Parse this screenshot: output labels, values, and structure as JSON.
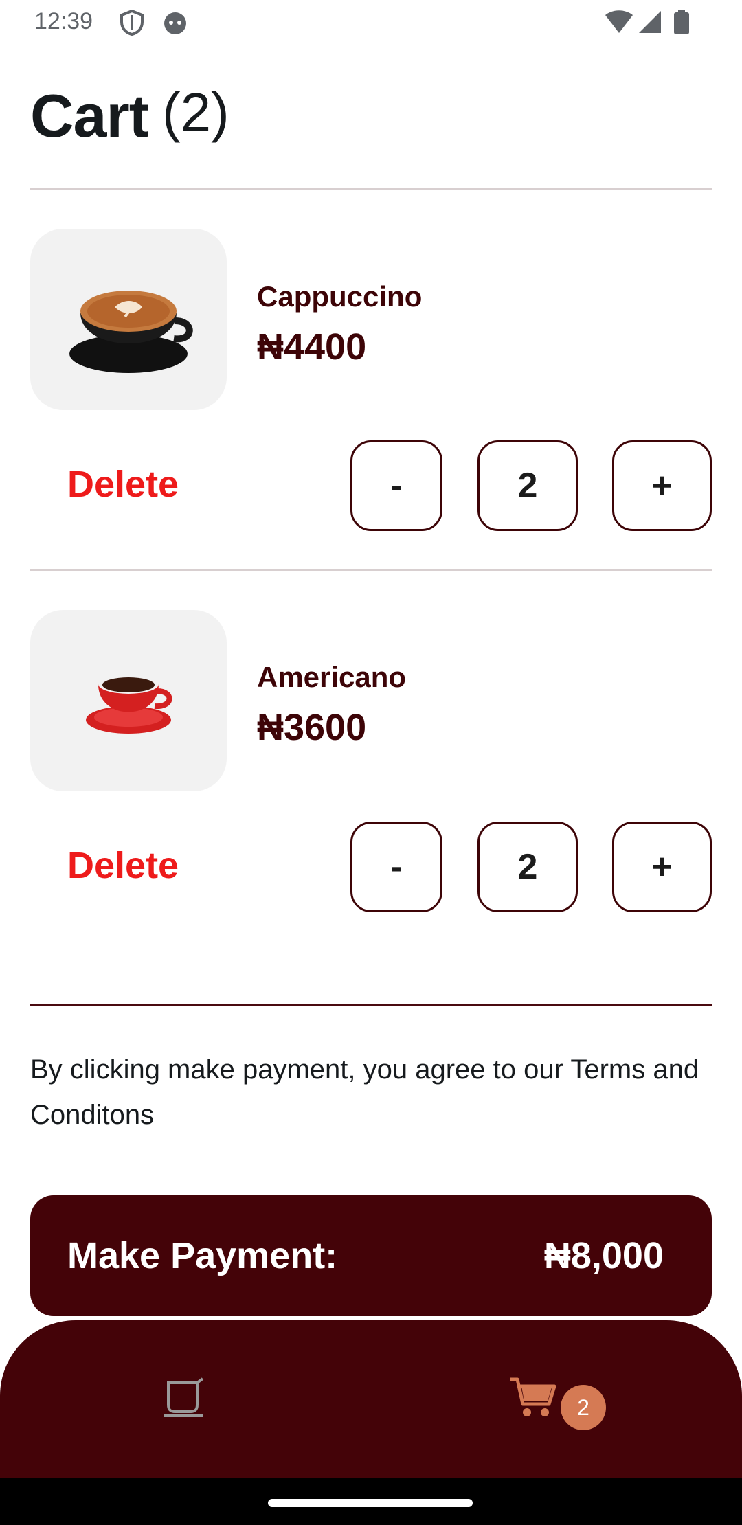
{
  "status_bar": {
    "time": "12:39"
  },
  "header": {
    "title": "Cart",
    "count": "(2)"
  },
  "cart": {
    "items": [
      {
        "name": "Cappuccino",
        "price": "₦4400",
        "quantity": "2",
        "delete_label": "Delete",
        "minus_label": "-",
        "plus_label": "+"
      },
      {
        "name": "Americano",
        "price": "₦3600",
        "quantity": "2",
        "delete_label": "Delete",
        "minus_label": "-",
        "plus_label": "+"
      }
    ]
  },
  "terms": {
    "text": "By clicking make payment, you agree to our Terms and Conditons"
  },
  "payment": {
    "label": "Make Payment:",
    "amount": "₦8,000"
  },
  "bottom_nav": {
    "items": [
      {
        "icon": "coffee-cup-icon",
        "active": false
      },
      {
        "icon": "cart-icon",
        "active": true,
        "badge": "2"
      }
    ]
  },
  "colors": {
    "primary": "#440308",
    "text_dark_red": "#3d0407",
    "delete": "#ee1b1b",
    "badge": "#d57a54"
  }
}
